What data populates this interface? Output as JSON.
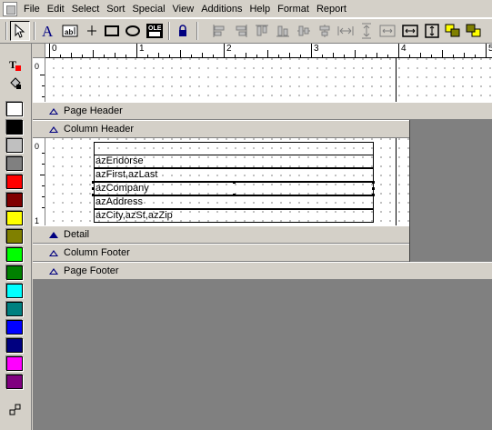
{
  "menubar": {
    "items": [
      "File",
      "Edit",
      "Select",
      "Sort",
      "Special",
      "View",
      "Additions",
      "Help",
      "Format",
      "Report"
    ]
  },
  "toolbar": {
    "tools": [
      "pointer-icon",
      "text-tool-icon",
      "field-tool-icon",
      "line-tool-icon",
      "rectangle-tool-icon",
      "oval-tool-icon",
      "ole-object-icon",
      "lock-icon",
      "align-left-icon",
      "align-right-icon",
      "align-top-icon",
      "align-bottom-icon",
      "center-horizontal-icon",
      "center-vertical-icon",
      "space-horizontal-icon",
      "space-vertical-icon",
      "same-size-icon",
      "same-width-icon",
      "same-height-icon",
      "bring-to-front-icon",
      "send-to-back-icon"
    ],
    "ole_label": "OLE"
  },
  "palette": {
    "swatches": [
      "#ffffff",
      "#000000",
      "#c0c0c0",
      "#808080",
      "#ff0000",
      "#800000",
      "#ffff00",
      "#808000",
      "#00ff00",
      "#008000",
      "#00ffff",
      "#008080",
      "#0000ff",
      "#000080",
      "#ff00ff",
      "#800080"
    ]
  },
  "ruler": {
    "labels": [
      "0",
      "1",
      "2",
      "3",
      "4",
      "5"
    ]
  },
  "bands": {
    "page_header": "Page Header",
    "column_header": "Column Header",
    "detail": "Detail",
    "column_footer": "Column Footer",
    "page_footer": "Page Footer"
  },
  "vruler": {
    "top_label": "0",
    "colhdr_label_0": "0",
    "colhdr_label_1": "1"
  },
  "fields": [
    "azEndorse",
    "azFirst,azLast",
    "azCompany",
    "azAddress",
    "azCity,azSt,azZip"
  ]
}
